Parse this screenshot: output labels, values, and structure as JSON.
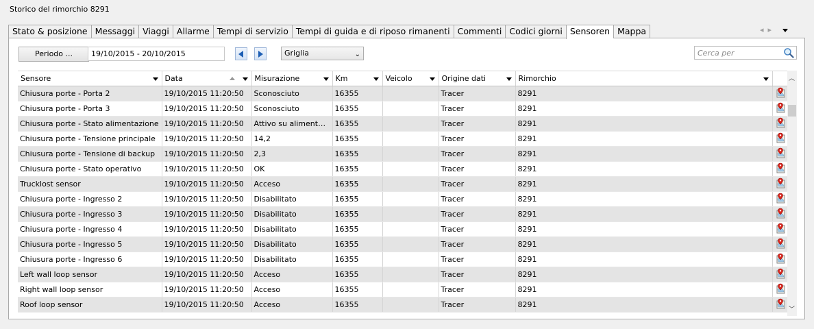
{
  "window": {
    "title": "Storico del rimorchio 8291"
  },
  "tabs": [
    {
      "label": "Stato & posizione",
      "active": false
    },
    {
      "label": "Messaggi",
      "active": false
    },
    {
      "label": "Viaggi",
      "active": false
    },
    {
      "label": "Allarme",
      "active": false
    },
    {
      "label": "Tempi di servizio",
      "active": false
    },
    {
      "label": "Tempi di guida e di riposo rimanenti",
      "active": false
    },
    {
      "label": "Commenti",
      "active": false
    },
    {
      "label": "Codici giorni",
      "active": false
    },
    {
      "label": "Sensoren",
      "active": true
    },
    {
      "label": "Mappa",
      "active": false
    }
  ],
  "toolbar": {
    "periodo_label": "Periodo ...",
    "date_range": "19/10/2015 - 20/10/2015",
    "view_select": "Griglia",
    "search_placeholder": "Cerca per"
  },
  "table": {
    "columns": [
      "Sensore",
      "Data",
      "Misurazione",
      "Km",
      "Veicolo",
      "Origine dati",
      "Rimorchio"
    ],
    "rows": [
      [
        "Chiusura porte - Porta 2",
        "19/10/2015 11:20:50",
        "Sconosciuto",
        "16355",
        "",
        "Tracer",
        "8291"
      ],
      [
        "Chiusura porte - Porta 3",
        "19/10/2015 11:20:50",
        "Sconosciuto",
        "16355",
        "",
        "Tracer",
        "8291"
      ],
      [
        "Chiusura porte - Stato alimentazione",
        "19/10/2015 11:20:50",
        "Attivo su alimentazi…",
        "16355",
        "",
        "Tracer",
        "8291"
      ],
      [
        "Chiusura porte - Tensione principale",
        "19/10/2015 11:20:50",
        "14,2",
        "16355",
        "",
        "Tracer",
        "8291"
      ],
      [
        "Chiusura porte - Tensione di backup",
        "19/10/2015 11:20:50",
        "2,3",
        "16355",
        "",
        "Tracer",
        "8291"
      ],
      [
        "Chiusura porte - Stato operativo",
        "19/10/2015 11:20:50",
        "OK",
        "16355",
        "",
        "Tracer",
        "8291"
      ],
      [
        "Trucklost sensor",
        "19/10/2015 11:20:50",
        "Acceso",
        "16355",
        "",
        "Tracer",
        "8291"
      ],
      [
        "Chiusura porte - Ingresso 2",
        "19/10/2015 11:20:50",
        "Disabilitato",
        "16355",
        "",
        "Tracer",
        "8291"
      ],
      [
        "Chiusura porte - Ingresso 3",
        "19/10/2015 11:20:50",
        "Disabilitato",
        "16355",
        "",
        "Tracer",
        "8291"
      ],
      [
        "Chiusura porte - Ingresso 4",
        "19/10/2015 11:20:50",
        "Disabilitato",
        "16355",
        "",
        "Tracer",
        "8291"
      ],
      [
        "Chiusura porte - Ingresso 5",
        "19/10/2015 11:20:50",
        "Disabilitato",
        "16355",
        "",
        "Tracer",
        "8291"
      ],
      [
        "Chiusura porte - Ingresso 6",
        "19/10/2015 11:20:50",
        "Disabilitato",
        "16355",
        "",
        "Tracer",
        "8291"
      ],
      [
        "Left wall loop sensor",
        "19/10/2015 11:20:50",
        "Acceso",
        "16355",
        "",
        "Tracer",
        "8291"
      ],
      [
        "Right wall loop sensor",
        "19/10/2015 11:20:50",
        "Acceso",
        "16355",
        "",
        "Tracer",
        "8291"
      ],
      [
        "Roof loop sensor",
        "19/10/2015 11:20:50",
        "Acceso",
        "16355",
        "",
        "Tracer",
        "8291"
      ]
    ]
  },
  "icons": {
    "row_action": "map-pin-document-icon",
    "search": "magnifier-icon",
    "prev": "arrow-left-icon",
    "next": "arrow-right-icon"
  },
  "colors": {
    "alt_row": "#e4e4e4",
    "accent": "#1e5fb4"
  }
}
